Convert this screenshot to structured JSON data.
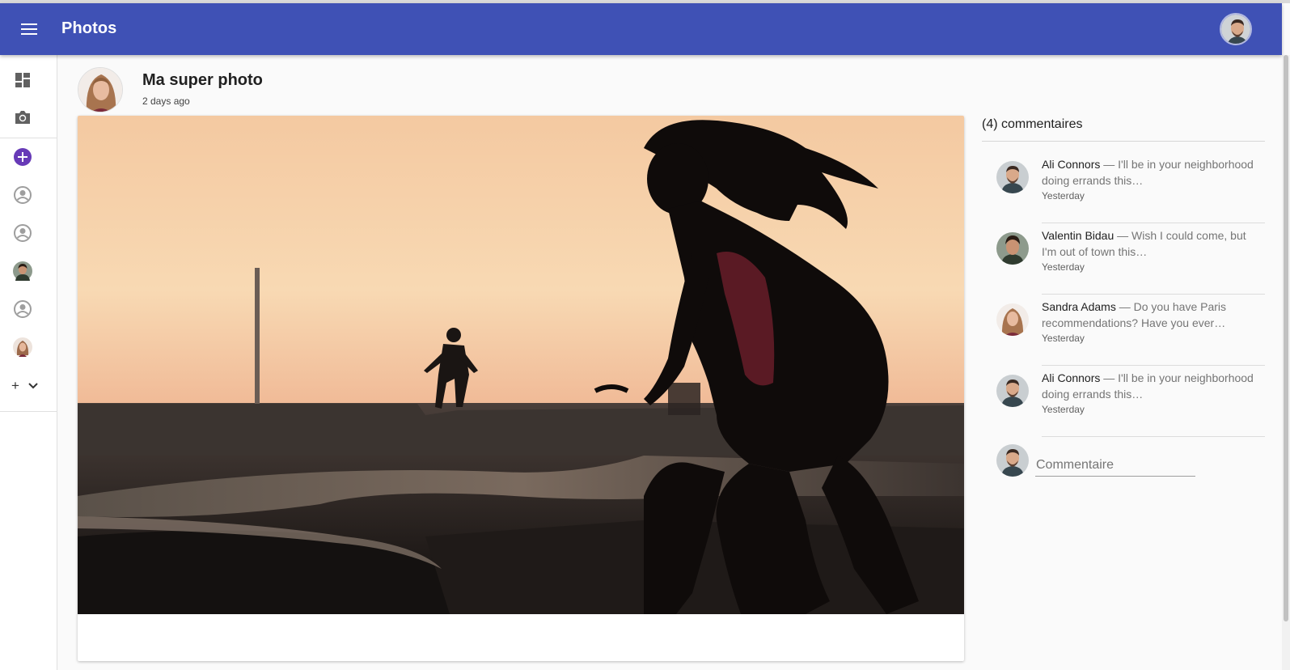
{
  "app": {
    "title": "Photos"
  },
  "post": {
    "title": "Ma super photo",
    "time": "2 days ago"
  },
  "comments": {
    "count_label": "(4) commentaires",
    "items": [
      {
        "author": "Ali Connors",
        "text": " — I'll be in your neighborhood doing errands this…",
        "when": "Yesterday"
      },
      {
        "author": "Valentin Bidau",
        "text": " — Wish I could come, but I'm out of town this…",
        "when": "Yesterday"
      },
      {
        "author": "Sandra Adams",
        "text": " — Do you have Paris recommendations? Have you ever…",
        "when": "Yesterday"
      },
      {
        "author": "Ali Connors",
        "text": " — I'll be in your neighborhood doing errands this…",
        "when": "Yesterday"
      }
    ],
    "input_placeholder": "Commentaire"
  },
  "sidebar": {
    "more_label": "+"
  },
  "colors": {
    "appbar": "#3f51b5",
    "accent": "#673ab7"
  }
}
